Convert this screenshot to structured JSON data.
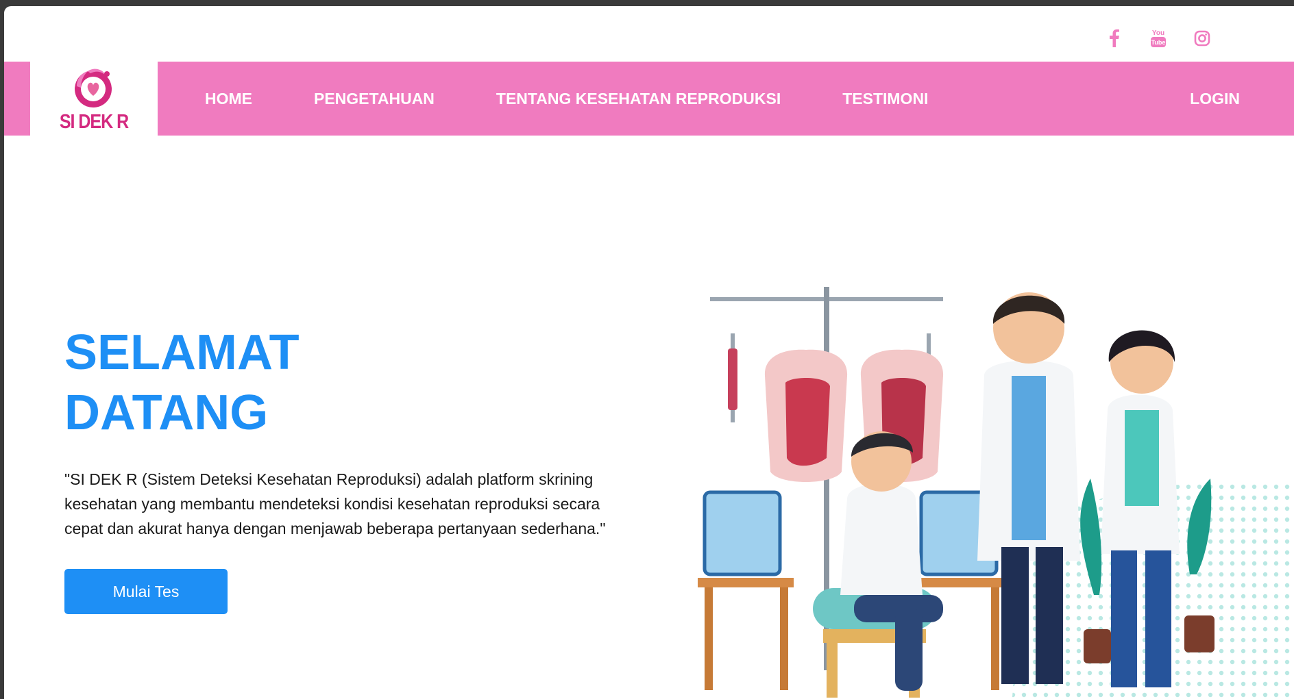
{
  "social": {
    "icons": [
      "facebook-icon",
      "youtube-icon",
      "instagram-icon"
    ],
    "youtube_text_top": "You",
    "youtube_text_bottom": "Tube",
    "color": "#f07bbf"
  },
  "logo": {
    "text": "SI DEK R",
    "color": "#d42a80"
  },
  "nav": {
    "background": "#f07bbf",
    "items": [
      {
        "label": "HOME"
      },
      {
        "label": "PENGETAHUAN"
      },
      {
        "label": "TENTANG KESEHATAN REPRODUKSI"
      },
      {
        "label": "TESTIMONI"
      }
    ],
    "login_label": "LOGIN"
  },
  "hero": {
    "title_line1": "SELAMAT",
    "title_line2": "DATANG",
    "description": "\"SI DEK R (Sistem Deteksi Kesehatan Reproduksi) adalah platform skrining kesehatan yang membantu mendeteksi kondisi kesehatan reproduksi secara cepat dan akurat hanya dengan menjawab beberapa pertanyaan sederhana.\"",
    "cta_label": "Mulai Tes",
    "accent": "#1e8ff5"
  }
}
